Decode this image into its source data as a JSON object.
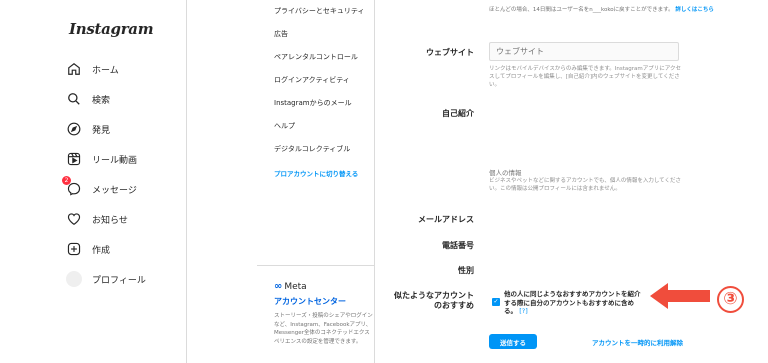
{
  "left_nav": {
    "logo": "Instagram",
    "items": [
      {
        "label": "ホーム",
        "icon": "home-icon"
      },
      {
        "label": "検索",
        "icon": "search-icon"
      },
      {
        "label": "発見",
        "icon": "compass-icon"
      },
      {
        "label": "リール動画",
        "icon": "reels-icon"
      },
      {
        "label": "メッセージ",
        "icon": "messenger-icon",
        "badge": "2"
      },
      {
        "label": "お知らせ",
        "icon": "heart-icon"
      },
      {
        "label": "作成",
        "icon": "plus-square-icon"
      },
      {
        "label": "プロフィール",
        "icon": "avatar"
      }
    ]
  },
  "settings_menu": {
    "items": [
      "プライバシーとセキュリティ",
      "広告",
      "ペアレンタルコントロール",
      "ログインアクティビティ",
      "Instagramからのメール",
      "ヘルプ",
      "デジタルコレクティブル"
    ],
    "pro_link": "プロアカウントに切り替える",
    "meta": {
      "logo": "Meta",
      "title": "アカウントセンター",
      "description": "ストーリーズ・投稿のシェアやログインなど、Instagram、Facebookアプリ、Messenger全体のコネクテッドエクスペリエンスの設定を管理できます。"
    }
  },
  "form": {
    "top_note": "ほとんどの場合、14日間はユーザー名をn___kokoに戻すことができます。",
    "top_note_link": "詳しくはこちら",
    "website_label": "ウェブサイト",
    "website_placeholder": "ウェブサイト",
    "website_help": "リンクはモバイルデバイスからのみ編集できます。Instagramアプリにアクセスしてプロフィールを編集し、[自己紹介]内のウェブサイトを変更してください。",
    "bio_label": "自己紹介",
    "personal_info_title": "個人の情報",
    "personal_info_help": "ビジネスやペットなどに関するアカウントでも、個人の情報を入力してください。この情報は公開プロフィールには含まれません。",
    "email_label": "メールアドレス",
    "phone_label": "電話番号",
    "gender_label": "性別",
    "suggest_label": "似たようなアカウントのおすすめ",
    "suggest_text": "他の人に同じようなおすすめアカウントを紹介する際に自分のアカウントもおすすめに含める。",
    "suggest_help": "[?]",
    "submit_label": "送信する",
    "disable_link": "アカウントを一時的に利用解除"
  },
  "annotation": {
    "step": "③",
    "color": "#f04d3c"
  }
}
